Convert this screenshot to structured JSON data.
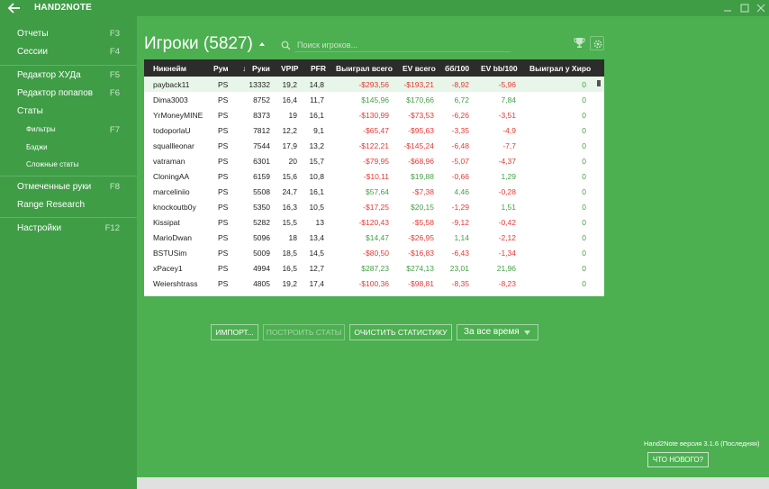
{
  "app": {
    "title": "HAND2NOTE"
  },
  "sidebar": {
    "items": [
      {
        "label": "Отчеты",
        "key": "F3"
      },
      {
        "label": "Сессии",
        "key": "F4"
      },
      {
        "label": "Редактор ХУДа",
        "key": "F5"
      },
      {
        "label": "Редактор попапов",
        "key": "F6"
      },
      {
        "label": "Статы",
        "key": ""
      },
      {
        "label": "Фильтры",
        "key": "F7"
      },
      {
        "label": "Бэджи",
        "key": ""
      },
      {
        "label": "Сложные статы",
        "key": ""
      },
      {
        "label": "Отмеченные руки",
        "key": "F8"
      },
      {
        "label": "Range Research",
        "key": ""
      },
      {
        "label": "Настройки",
        "key": "F12"
      }
    ]
  },
  "main": {
    "title": "Игроки (5827)",
    "search_placeholder": "Поиск игроков..."
  },
  "table": {
    "headers": [
      "Никнейм",
      "Рум",
      "Руки",
      "VPIP",
      "PFR",
      "Выиграл всего",
      "EV всего",
      "бб/100",
      "EV bb/100",
      "Выиграл у Хиро"
    ],
    "sort_arrow": "↓",
    "rows": [
      [
        "payback11",
        "PS",
        "13332",
        "19,2",
        "14,8",
        "-$293,56",
        "-$193,21",
        "-8,92",
        "-5,96",
        "0"
      ],
      [
        "Dima3003",
        "PS",
        "8752",
        "16,4",
        "11,7",
        "$145,96",
        "$170,66",
        "6,72",
        "7,84",
        "0"
      ],
      [
        "YrMoneyMINE",
        "PS",
        "8373",
        "19",
        "16,1",
        "-$130,99",
        "-$73,53",
        "-6,26",
        "-3,51",
        "0"
      ],
      [
        "todoporlaU",
        "PS",
        "7812",
        "12,2",
        "9,1",
        "-$65,47",
        "-$95,63",
        "-3,35",
        "-4,9",
        "0"
      ],
      [
        "squallleonar",
        "PS",
        "7544",
        "17,9",
        "13,2",
        "-$122,21",
        "-$145,24",
        "-6,48",
        "-7,7",
        "0"
      ],
      [
        "vatraman",
        "PS",
        "6301",
        "20",
        "15,7",
        "-$79,95",
        "-$68,96",
        "-5,07",
        "-4,37",
        "0"
      ],
      [
        "CloningAA",
        "PS",
        "6159",
        "15,6",
        "10,8",
        "-$10,11",
        "$19,88",
        "-0,66",
        "1,29",
        "0"
      ],
      [
        "marceliniio",
        "PS",
        "5508",
        "24,7",
        "16,1",
        "$57,64",
        "-$7,38",
        "4,46",
        "-0,28",
        "0"
      ],
      [
        "knockoutb0y",
        "PS",
        "5350",
        "16,3",
        "10,5",
        "-$17,25",
        "$20,15",
        "-1,29",
        "1,51",
        "0"
      ],
      [
        "Kissipat",
        "PS",
        "5282",
        "15,5",
        "13",
        "-$120,43",
        "-$5,58",
        "-9,12",
        "-0,42",
        "0"
      ],
      [
        "MarioDwan",
        "PS",
        "5096",
        "18",
        "13,4",
        "$14,47",
        "-$26,95",
        "1,14",
        "-2,12",
        "0"
      ],
      [
        "BSTUSim",
        "PS",
        "5009",
        "18,5",
        "14,5",
        "-$80,50",
        "-$16,83",
        "-6,43",
        "-1,34",
        "0"
      ],
      [
        "xPacey1",
        "PS",
        "4994",
        "16,5",
        "12,7",
        "$287,23",
        "$274,13",
        "23,01",
        "21,96",
        "0"
      ],
      [
        "Weiershtrass",
        "PS",
        "4805",
        "19,2",
        "17,4",
        "-$100,36",
        "-$98,81",
        "-8,35",
        "-8,23",
        "0"
      ]
    ]
  },
  "actions": {
    "import": "ИМПОРТ...",
    "build_stats": "ПОСТРОИТЬ СТАТЫ",
    "clear_stats": "ОЧИСТИТЬ СТАТИСТИКУ",
    "period": "За все время"
  },
  "footer": {
    "version": "Hand2Note версия 3.1.6 (Последняя)",
    "whats_new": "ЧТО НОВОГО?"
  },
  "colors": {
    "accent": "#4caf50",
    "sidebar": "#3f9d46",
    "negative": "#e53935",
    "positive": "#43a047"
  }
}
